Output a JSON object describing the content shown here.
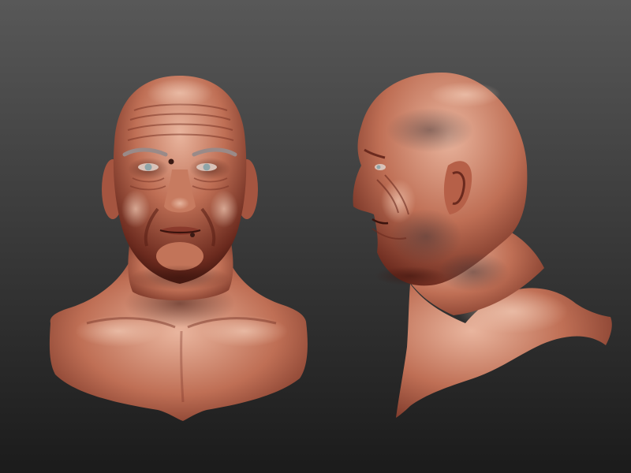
{
  "scene": {
    "background_top": "#585858",
    "background_bottom": "#1b1b1b",
    "skin_highlight": "#e9b59e",
    "skin_mid": "#bf6f55",
    "skin_shadow": "#6b2a1e",
    "skin_deep": "#3a130d",
    "iris_color": "#8fa5a8",
    "brow_color": "#9a8a88"
  },
  "sculpts": [
    {
      "label": "bust-front-view"
    },
    {
      "label": "bust-side-profile-view"
    }
  ]
}
